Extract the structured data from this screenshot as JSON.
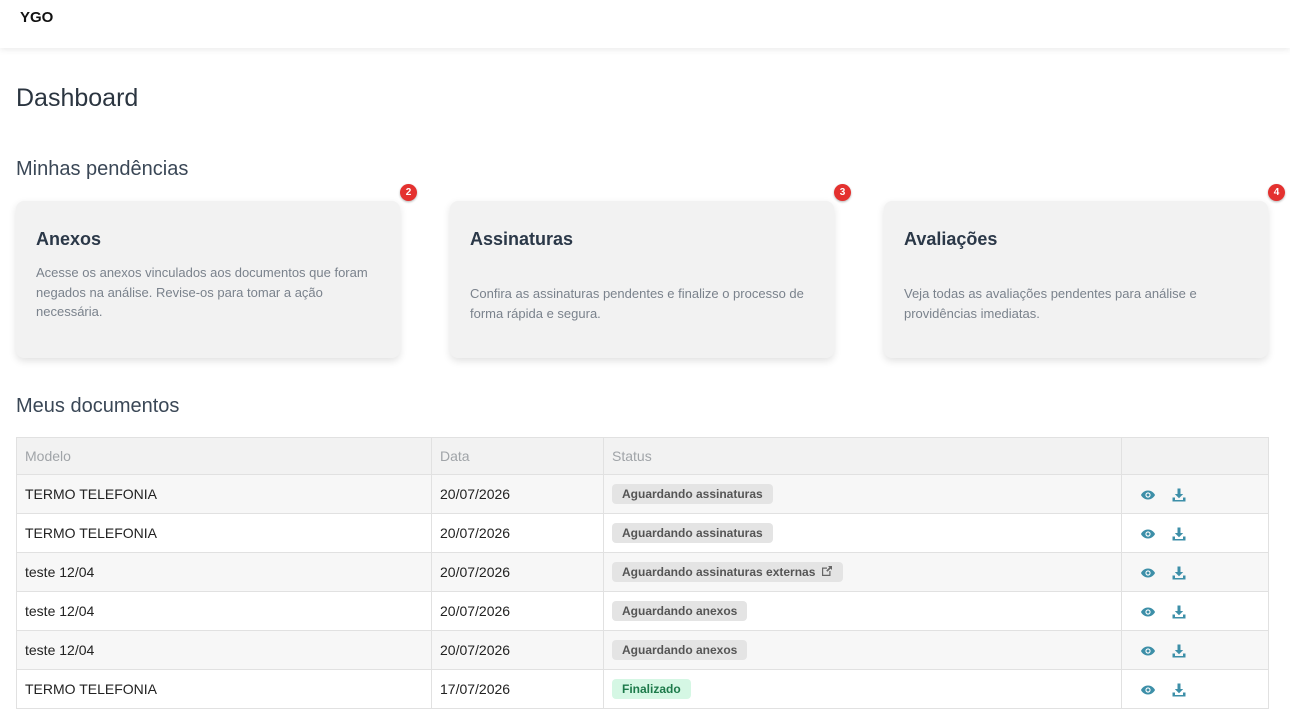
{
  "header": {
    "brand": "YGO"
  },
  "page": {
    "title": "Dashboard"
  },
  "pendencias": {
    "title": "Minhas pendências",
    "cards": [
      {
        "title": "Anexos",
        "description": "Acesse os anexos vinculados aos documentos que foram negados na análise. Revise-os para tomar a ação necessária.",
        "count": "2"
      },
      {
        "title": "Assinaturas",
        "description": "Confira as assinaturas pendentes e finalize o processo de forma rápida e segura.",
        "count": "3"
      },
      {
        "title": "Avaliações",
        "description": "Veja todas as avaliações pendentes para análise e providências imediatas.",
        "count": "4"
      }
    ]
  },
  "documentos": {
    "title": "Meus documentos",
    "columns": [
      "Modelo",
      "Data",
      "Status",
      ""
    ],
    "rows": [
      {
        "modelo": "TERMO TELEFONIA",
        "data": "20/07/2026",
        "status": "Aguardando assinaturas"
      },
      {
        "modelo": "TERMO TELEFONIA",
        "data": "20/07/2026",
        "status": "Aguardando assinaturas"
      },
      {
        "modelo": "teste 12/04",
        "data": "20/07/2026",
        "status": "Aguardando assinaturas externas"
      },
      {
        "modelo": "teste 12/04",
        "data": "20/07/2026",
        "status": "Aguardando anexos"
      },
      {
        "modelo": "teste 12/04",
        "data": "20/07/2026",
        "status": "Aguardando anexos"
      },
      {
        "modelo": "TERMO TELEFONIA",
        "data": "17/07/2026",
        "status": "Finalizado"
      }
    ]
  },
  "icons": {
    "view": "eye-icon",
    "download": "download-icon",
    "external": "external-link-icon"
  },
  "colors": {
    "badge": "#e4312f",
    "action_icon": "#3d8fa8",
    "success_bg": "#d5f7e4",
    "success_text": "#1d7a4a"
  }
}
